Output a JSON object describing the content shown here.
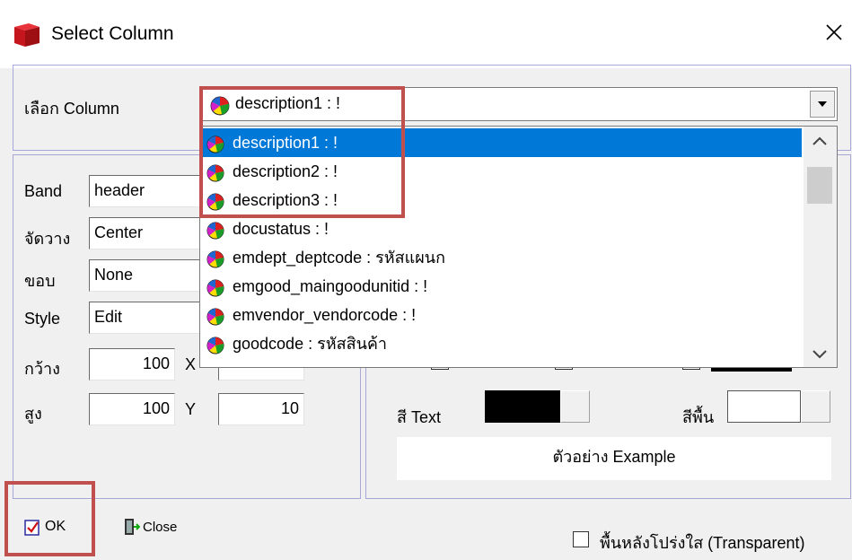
{
  "window": {
    "title": "Select Column"
  },
  "column_select": {
    "label": "เลือก Column",
    "selected": "description1 : !",
    "options": [
      "description1 : !",
      "description2 : !",
      "description3 : !",
      "docustatus : !",
      "emdept_deptcode : รหัสแผนก",
      "emgood_maingoodunitid : !",
      "emvendor_vendorcode : !",
      "goodcode : รหัสสินค้า"
    ]
  },
  "props": {
    "band_label": "Band",
    "band_value": "header",
    "align_label": "จัดวาง",
    "align_value": "Center",
    "border_label": "ขอบ",
    "border_value": "None",
    "style_label": "Style",
    "style_value": "Edit",
    "width_label": "กว้าง",
    "width_value": "100",
    "x_label": "X",
    "height_label": "สูง",
    "height_value": "100",
    "y_label": "Y",
    "y_value": "10"
  },
  "colors": {
    "text_color_label": "สี Text",
    "text_color": "#000000",
    "bg_color_label": "สีพื้น",
    "bg_color": "#ffffff",
    "preview_text": "ตัวอย่าง Example",
    "highlight": "#c0504d",
    "selection": "#0078d7"
  },
  "footer": {
    "ok_label": "OK",
    "close_label": "Close",
    "transparent_label": "พื้นหลังโปร่งใส (Transparent)"
  }
}
